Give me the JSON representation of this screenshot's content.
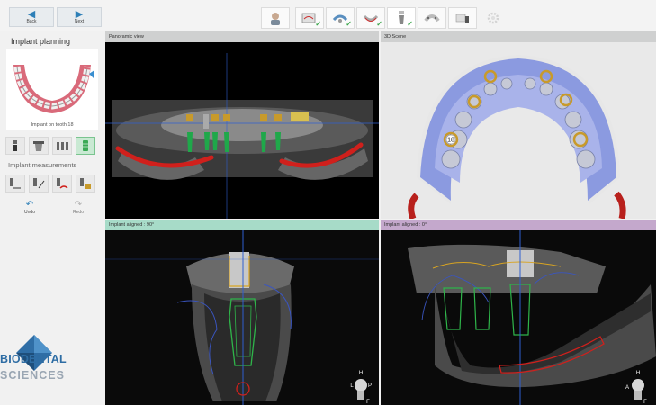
{
  "toolbar": {
    "back_label": "Back",
    "next_label": "Next",
    "steps": [
      {
        "icon": "patient-icon",
        "checked": false
      },
      {
        "icon": "scan-data-icon",
        "checked": true
      },
      {
        "icon": "segmentation-icon",
        "checked": true
      },
      {
        "icon": "nerve-icon",
        "checked": true
      },
      {
        "icon": "implant-icon",
        "checked": true
      },
      {
        "icon": "guide-design-icon",
        "checked": false
      },
      {
        "icon": "export-icon",
        "checked": false
      }
    ]
  },
  "sidebar": {
    "title": "Implant planning",
    "caption": "Implant on tooth 18",
    "measurements_title": "Implant measurements",
    "undo_label": "Undo",
    "redo_label": "Redo",
    "logo_line1": "BIODENTAL",
    "logo_line2": "SCIENCES"
  },
  "panels": {
    "panoramic": {
      "title": "Panoramic view"
    },
    "scene3d": {
      "title": "3D Scene",
      "tooth_label": "18"
    },
    "aligned90": {
      "title": "Implant aligned : 90°",
      "orient": [
        "H",
        "L",
        "P",
        "F"
      ]
    },
    "aligned0": {
      "title": "Implant aligned : 0°",
      "orient": [
        "H",
        "A",
        "F"
      ]
    }
  },
  "colors": {
    "accent": "#2d7fb7",
    "panel90_header": "#a7dbc8",
    "panel0_header": "#c4a8cc",
    "nerve": "#d0201c",
    "implant": "#2fb54a",
    "abutment": "#d8a422"
  }
}
